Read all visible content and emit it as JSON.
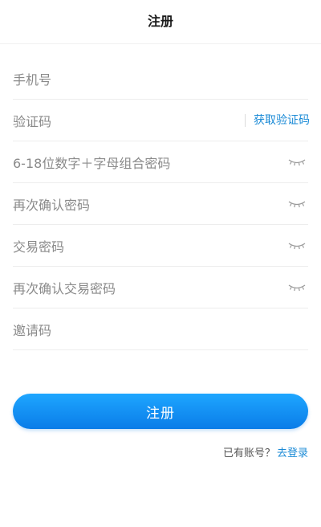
{
  "header": {
    "title": "注册"
  },
  "form": {
    "fields": [
      {
        "name": "phone",
        "placeholder": "手机号",
        "has_eye": false
      },
      {
        "name": "verify-code",
        "placeholder": "验证码",
        "action": "获取验证码"
      },
      {
        "name": "password",
        "placeholder": "6-18位数字＋字母组合密码",
        "has_eye": true
      },
      {
        "name": "password-confirm",
        "placeholder": "再次确认密码",
        "has_eye": true
      },
      {
        "name": "trade-password",
        "placeholder": "交易密码",
        "has_eye": true
      },
      {
        "name": "trade-password-confirm",
        "placeholder": "再次确认交易密码",
        "has_eye": true
      },
      {
        "name": "invite-code",
        "placeholder": "邀请码",
        "has_eye": false
      }
    ]
  },
  "actions": {
    "register_label": "注册",
    "login_question": "已有账号？",
    "login_link": "去登录"
  },
  "colors": {
    "accent": "#1a8ad6",
    "button_top": "#1ea6ff",
    "button_bottom": "#0a7ce8"
  },
  "icons": {
    "eye": "eye-closed-icon"
  }
}
